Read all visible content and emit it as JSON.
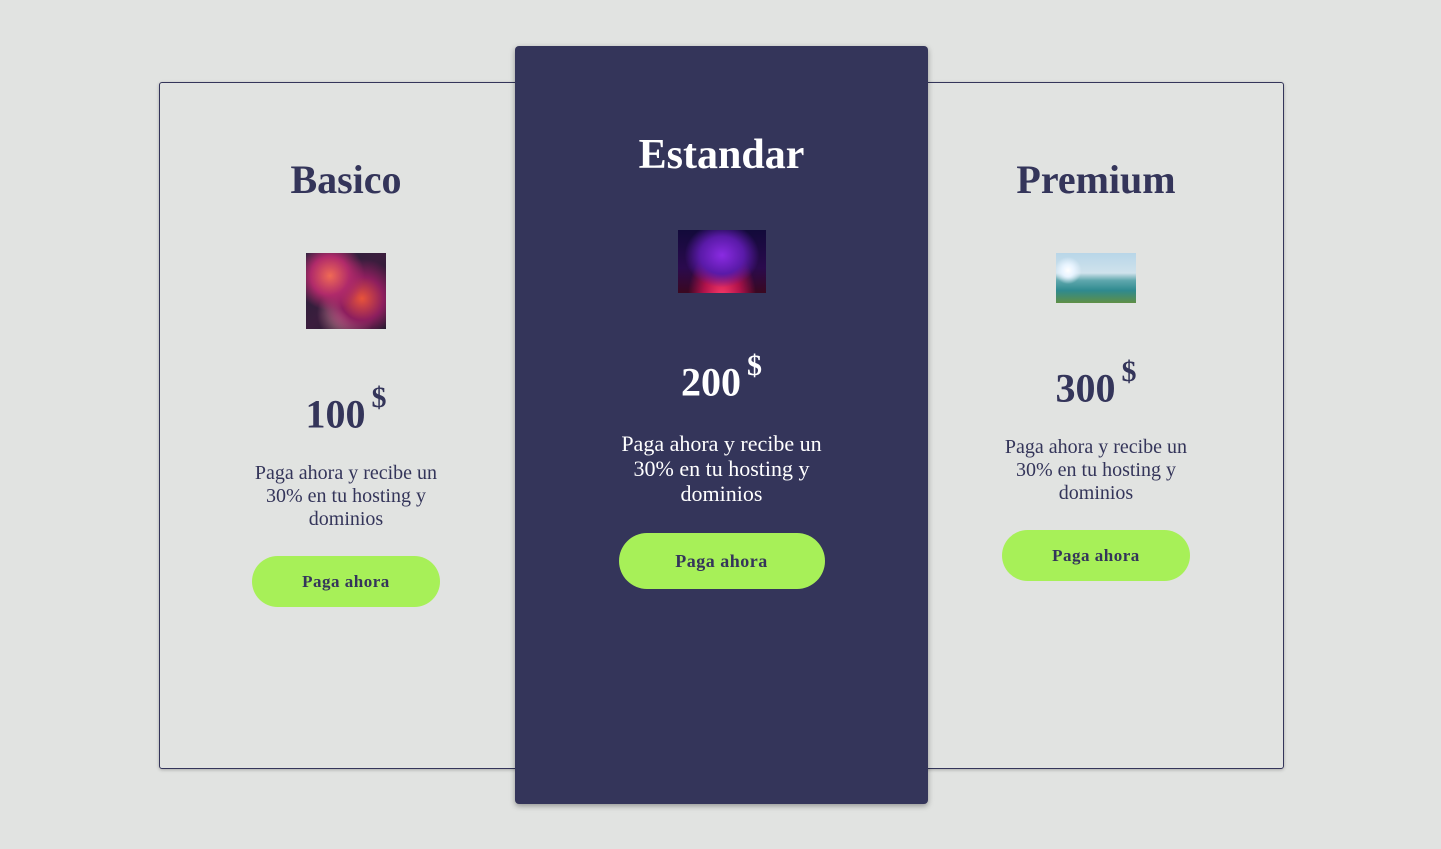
{
  "plans": {
    "basic": {
      "title": "Basico",
      "image": "abstract-3d-swirl-image",
      "price": "100",
      "currency": "$",
      "description": "Paga ahora y recibe un 30% en tu hosting y dominios",
      "button_label": "Paga ahora"
    },
    "standard": {
      "title": "Estandar",
      "image": "purple-planet-horizon-image",
      "price": "200",
      "currency": "$",
      "description": "Paga ahora y recibe un 30% en tu hosting y dominios",
      "button_label": "Paga ahora"
    },
    "premium": {
      "title": "Premium",
      "image": "lake-landscape-image",
      "price": "300",
      "currency": "$",
      "description": "Paga ahora y recibe un 30% en tu hosting y dominios",
      "button_label": "Paga ahora"
    }
  },
  "colors": {
    "background": "#e1e3e1",
    "navy": "#34355a",
    "accent_green": "#a7f058",
    "white": "#ffffff"
  }
}
